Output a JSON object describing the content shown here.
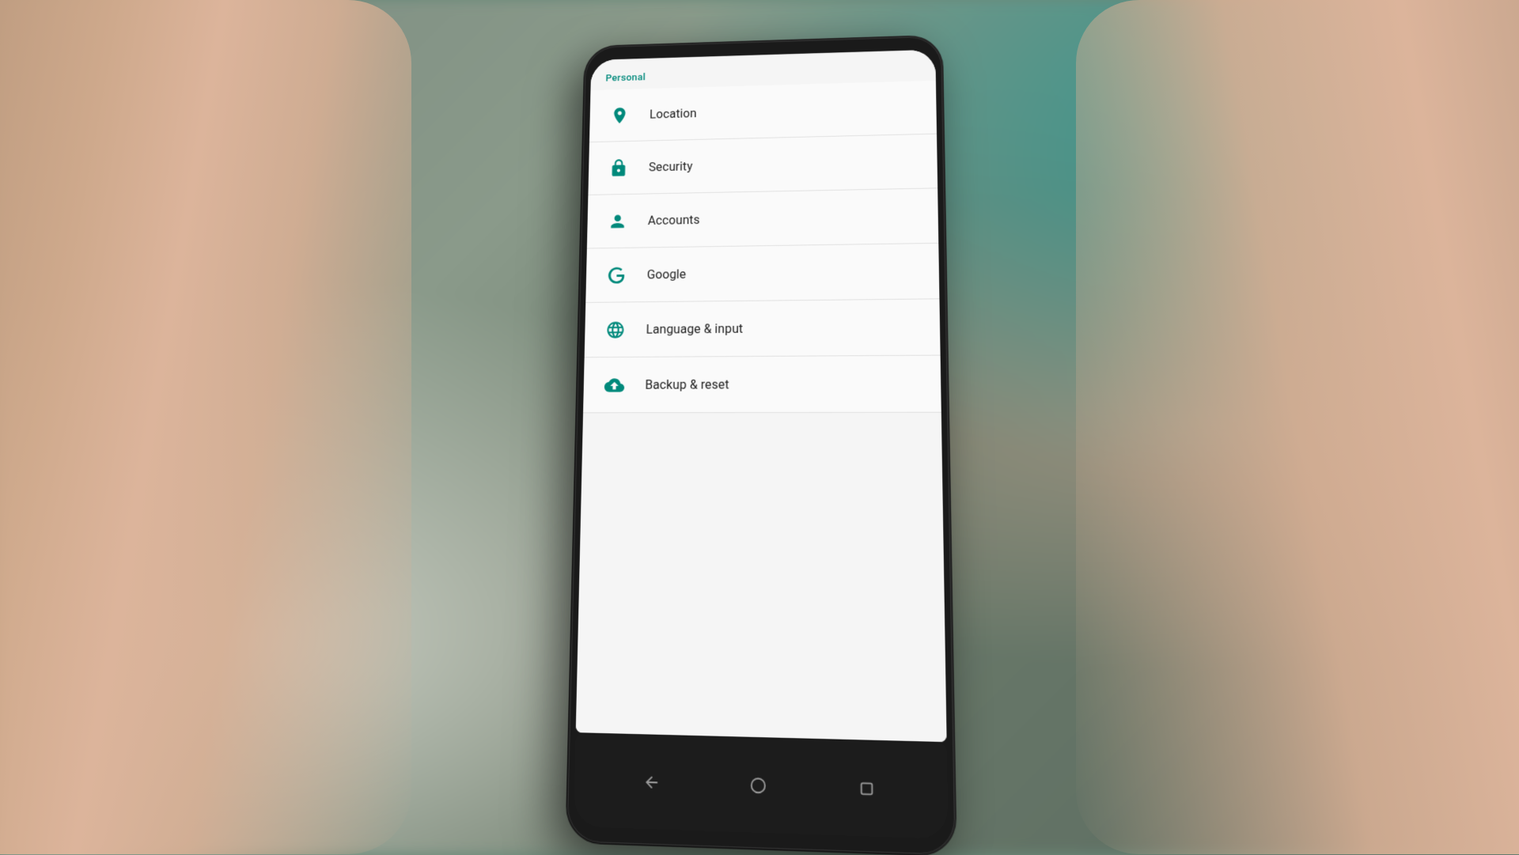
{
  "background": {
    "color": "#7a8a80"
  },
  "phone": {
    "section": {
      "title": "Personal"
    },
    "settings_items": [
      {
        "id": "location",
        "label": "Location",
        "icon": "location-icon"
      },
      {
        "id": "security",
        "label": "Security",
        "icon": "security-icon"
      },
      {
        "id": "accounts",
        "label": "Accounts",
        "icon": "accounts-icon"
      },
      {
        "id": "google",
        "label": "Google",
        "icon": "google-icon"
      },
      {
        "id": "language",
        "label": "Language & input",
        "icon": "language-icon"
      },
      {
        "id": "backup",
        "label": "Backup & reset",
        "icon": "backup-icon"
      }
    ],
    "nav": {
      "back_label": "back",
      "home_label": "home",
      "recents_label": "recents"
    }
  }
}
